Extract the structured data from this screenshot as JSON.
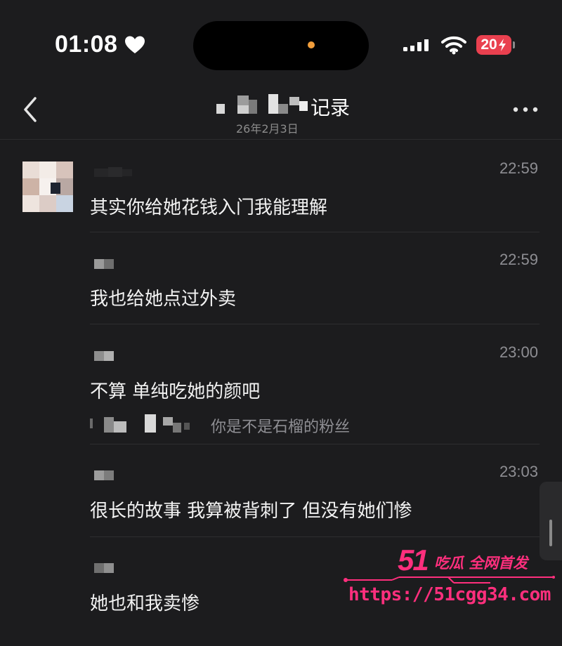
{
  "status_bar": {
    "time": "01:08",
    "battery": "20",
    "icons": [
      "heart-icon",
      "signal-icon",
      "wifi-icon",
      "charging-icon"
    ]
  },
  "nav": {
    "title_suffix": "记录",
    "subtitle_visible": "26年2月3日",
    "icons": [
      "chevron-left-icon",
      "more-dots-icon"
    ]
  },
  "messages": [
    {
      "time": "22:59",
      "text": "其实你给她花钱入门我能理解"
    },
    {
      "time": "22:59",
      "text": "我也给她点过外卖"
    },
    {
      "time": "23:00",
      "text": "不算 单纯吃她的颜吧",
      "quote": "你是不是石榴的粉丝"
    },
    {
      "time": "23:03",
      "text": "很长的故事 我算被背刺了 但没有她们惨"
    },
    {
      "text": "她也和我卖惨"
    }
  ],
  "watermark": {
    "brand_number": "51",
    "brand_text": "吃瓜 全网首发",
    "url": "https://51cgg34.com"
  },
  "colors": {
    "background": "#1c1c1e",
    "text": "#f2f2f2",
    "muted": "#8e8e93",
    "battery": "#e9404f",
    "watermark": "#ff2f7d",
    "island_dot": "#f29e3b"
  }
}
